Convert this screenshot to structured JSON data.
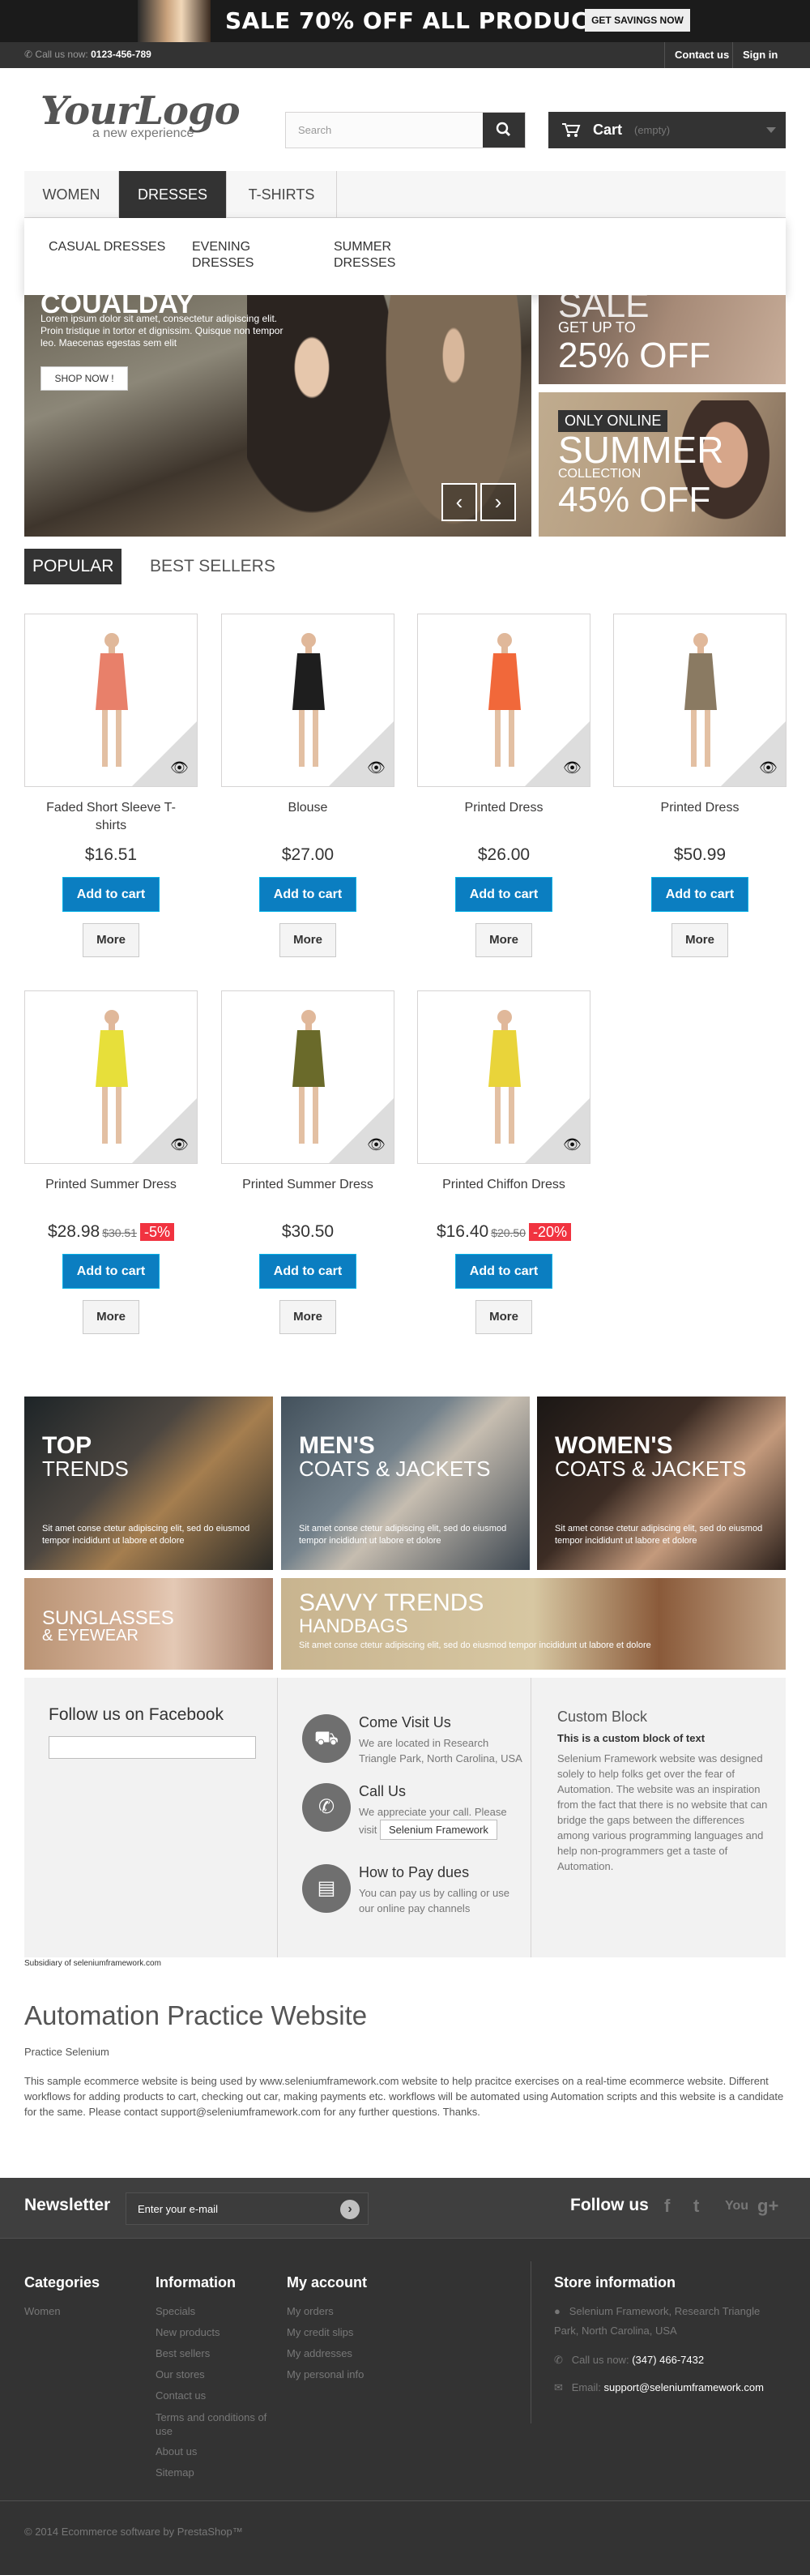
{
  "banner": {
    "text": "SALE 70% OFF ALL PRODUCTS",
    "button": "GET SAVINGS NOW"
  },
  "navbar": {
    "phone_label": "Call us now:",
    "phone": "0123-456-789",
    "contact": "Contact us",
    "signin": "Sign in"
  },
  "logo": {
    "line1": "YourLogo",
    "line2": "a new experience"
  },
  "search": {
    "placeholder": "Search"
  },
  "cart": {
    "label": "Cart",
    "state": "(empty)"
  },
  "menu": {
    "items": [
      "WOMEN",
      "DRESSES",
      "T-SHIRTS"
    ],
    "active": "DRESSES",
    "sub": [
      "CASUAL DRESSES",
      "EVENING DRESSES",
      "SUMMER DRESSES"
    ]
  },
  "slider": {
    "heading": "Coualday",
    "body": "Lorem ipsum dolor sit amet, consectetur adipiscing elit. Proin tristique in tortor et dignissim. Quisque non tempor leo. Maecenas egestas sem elit",
    "button": "SHOP NOW !",
    "prev": "‹",
    "next": "›"
  },
  "promo1": {
    "t1": "SALE",
    "t2": "GET UP TO",
    "t3": "25% OFF"
  },
  "promo2": {
    "badge": "ONLY ONLINE",
    "big": "SUMMER",
    "small": "COLLECTION",
    "pct": "45% OFF"
  },
  "tabs": [
    "POPULAR",
    "BEST SELLERS"
  ],
  "products": [
    {
      "name": "Faded Short Sleeve T-shirts",
      "price": "$16.51",
      "old": "",
      "discount": "",
      "color": "#e8806a"
    },
    {
      "name": "Blouse",
      "price": "$27.00",
      "old": "",
      "discount": "",
      "color": "#1e1e1e"
    },
    {
      "name": "Printed Dress",
      "price": "$26.00",
      "old": "",
      "discount": "",
      "color": "#f1683a"
    },
    {
      "name": "Printed Dress",
      "price": "$50.99",
      "old": "",
      "discount": "",
      "color": "#8a7a62"
    },
    {
      "name": "Printed Summer Dress",
      "price": "$28.98",
      "old": "$30.51",
      "discount": "-5%",
      "color": "#e7df3a"
    },
    {
      "name": "Printed Summer Dress",
      "price": "$30.50",
      "old": "",
      "discount": "",
      "color": "#6a6a2a"
    },
    {
      "name": "Printed Chiffon Dress",
      "price": "$16.40",
      "old": "$20.50",
      "discount": "-20%",
      "color": "#e9d43a"
    }
  ],
  "product_buttons": {
    "add": "Add to cart",
    "more": "More"
  },
  "banners": [
    {
      "h1": "TOP",
      "h2": "TRENDS",
      "p": "Sit amet conse ctetur adipiscing elit, sed do eiusmod tempor incididunt ut labore et dolore"
    },
    {
      "h1": "MEN'S",
      "h2": "COATS & JACKETS",
      "p": "Sit amet conse ctetur adipiscing elit, sed do eiusmod tempor incididunt ut labore et dolore"
    },
    {
      "h1": "WOMEN'S",
      "h2": "COATS & JACKETS",
      "p": "Sit amet conse ctetur adipiscing elit, sed do eiusmod tempor incididunt ut labore et dolore"
    },
    {
      "h1": "SUNGLASSES",
      "h2": "& EYEWEAR",
      "p": ""
    },
    {
      "h1": "SAVVY TRENDS",
      "h2": "HANDBAGS",
      "p": "Sit amet conse ctetur adipiscing elit, sed do eiusmod tempor incididunt ut labore et dolore"
    }
  ],
  "facebook": {
    "title": "Follow us on Facebook"
  },
  "cms": [
    {
      "title": "Come Visit Us",
      "desc": "We are located in Research Triangle Park, North Carolina, USA"
    },
    {
      "title": "Call Us",
      "desc": "We appreciate your call. Please visit",
      "button": "Selenium Framework"
    },
    {
      "title": "How to Pay dues",
      "desc": "You can pay us by calling or use our online pay channels"
    }
  ],
  "custom": {
    "title": "Custom Block",
    "subtitle": "This is a custom block of text",
    "text": "Selenium Framework website was designed solely to help folks get over the fear of Automation. The website was an inspiration from the fact that there is no website that can bridge the gaps between the differences among various programming languages and help non-programmers get a taste of Automation."
  },
  "subsidiary": "Subsidiary of seleniumframework.com",
  "about": {
    "title": "Automation Practice Website",
    "subtitle": "Practice Selenium",
    "text": "This sample ecommerce website is being used by www.seleniumframework.com website to help pracitce exercises on a real-time ecommerce website. Different workflows for adding products to cart, checking out car, making payments etc. workflows will be automated using Automation scripts and this website is a candidate for the same. Please contact support@seleniumframework.com for any further questions. Thanks."
  },
  "newsletter": {
    "title": "Newsletter",
    "placeholder": "Enter your e-mail",
    "follow": "Follow us",
    "social": [
      "f",
      "t",
      "You",
      "g+"
    ]
  },
  "footer": {
    "categories": {
      "title": "Categories",
      "items": [
        "Women"
      ]
    },
    "information": {
      "title": "Information",
      "items": [
        "Specials",
        "New products",
        "Best sellers",
        "Our stores",
        "Contact us",
        "Terms and conditions of use",
        "About us",
        "Sitemap"
      ]
    },
    "account": {
      "title": "My account",
      "items": [
        "My orders",
        "My credit slips",
        "My addresses",
        "My personal info"
      ]
    },
    "store": {
      "title": "Store information",
      "address": "Selenium Framework, Research Triangle Park, North Carolina, USA",
      "call_label": "Call us now:",
      "phone": "(347) 466-7432",
      "email_label": "Email:",
      "email": "support@seleniumframework.com"
    },
    "copyright": "© 2014 Ecommerce software by PrestaShop™"
  }
}
